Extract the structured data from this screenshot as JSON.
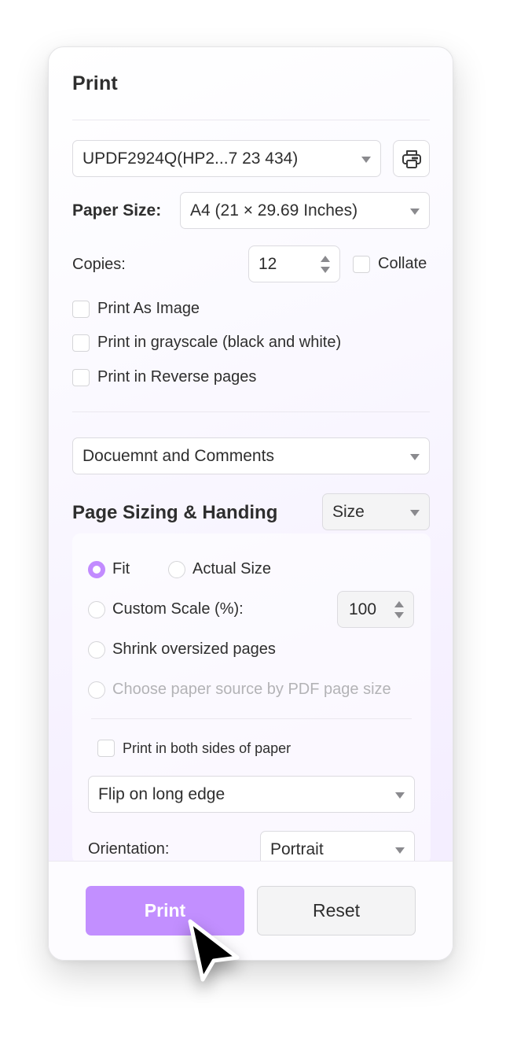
{
  "dialog": {
    "title": "Print"
  },
  "printer": {
    "selected": "UPDF2924Q(HP2...7 23 434)",
    "settings_icon": "printer-icon"
  },
  "paper_size": {
    "label": "Paper Size:",
    "selected": "A4 (21 × 29.69 Inches)"
  },
  "copies": {
    "label": "Copies:",
    "value": "12",
    "collate_label": "Collate",
    "collate_checked": false
  },
  "options": [
    {
      "label": "Print As Image",
      "checked": false
    },
    {
      "label": "Print in grayscale (black and white)",
      "checked": false
    },
    {
      "label": "Print in Reverse pages",
      "checked": false
    }
  ],
  "content_select": {
    "selected": "Docuemnt and Comments"
  },
  "page_sizing": {
    "heading": "Page Sizing & Handing",
    "mode_selected": "Size",
    "radios": {
      "fit": {
        "label": "Fit",
        "selected": true
      },
      "actual_size": {
        "label": "Actual Size",
        "selected": false
      },
      "custom_scale": {
        "label": "Custom Scale (%):",
        "selected": false
      },
      "shrink": {
        "label": "Shrink oversized pages",
        "selected": false
      },
      "paper_source": {
        "label": "Choose paper source by PDF page size",
        "selected": false,
        "disabled": true
      }
    },
    "custom_scale_value": "100",
    "duplex": {
      "label": "Print in both sides of paper",
      "checked": false,
      "flip_selected": "Flip on long edge"
    },
    "orientation": {
      "label": "Orientation:",
      "selected": "Portrait"
    }
  },
  "footer": {
    "print_label": "Print",
    "reset_label": "Reset"
  },
  "colors": {
    "accent": "#c28fff",
    "radio_selected": "#c28bff"
  }
}
